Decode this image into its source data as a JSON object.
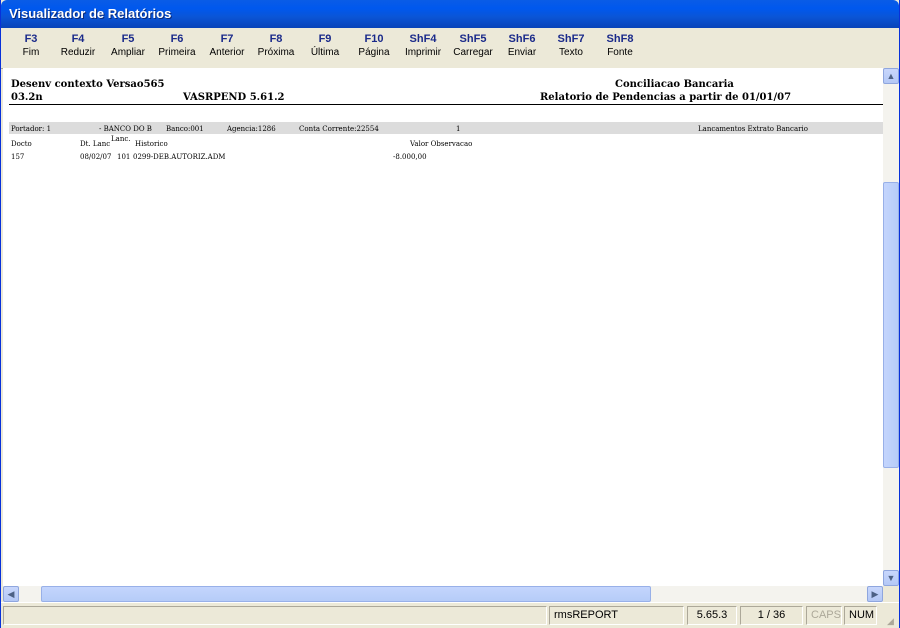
{
  "window": {
    "title": "Visualizador de Relatórios"
  },
  "toolbar": {
    "buttons": [
      {
        "key": "F3",
        "label": "Fim"
      },
      {
        "key": "F4",
        "label": "Reduzir"
      },
      {
        "key": "F5",
        "label": "Ampliar"
      },
      {
        "key": "F6",
        "label": "Primeira"
      },
      {
        "key": "F7",
        "label": "Anterior"
      },
      {
        "key": "F8",
        "label": "Próxima"
      },
      {
        "key": "F9",
        "label": "Última"
      },
      {
        "key": "F10",
        "label": "Página"
      },
      {
        "key": "ShF4",
        "label": "Imprimir"
      },
      {
        "key": "ShF5",
        "label": "Carregar"
      },
      {
        "key": "ShF6",
        "label": "Enviar"
      },
      {
        "key": "ShF7",
        "label": "Texto"
      },
      {
        "key": "ShF8",
        "label": "Fonte"
      }
    ]
  },
  "report": {
    "header_left_1": "Desenv contexto Versao565",
    "header_left_2": "03.2n",
    "header_center": "VASRPEND 5.61.2",
    "header_right_1": "Conciliacao Bancaria",
    "header_right_2": "Relatorio de Pendencias a partir de 01/01/07",
    "band": {
      "portador": "Portador: 1",
      "banco_nome": "- BANCO DO B",
      "banco": "Banco:001",
      "agencia": "Agencia:1286",
      "conta": "Conta Corrente:22554",
      "seq": "1",
      "titulo": "Lancamentos Extrato Bancario"
    },
    "columns": {
      "docto": "Docto",
      "dt_lanc": "Dt. Lanc",
      "lanc": "Lanc.",
      "historico": "Historico",
      "valor_obs": "Valor Observacao"
    },
    "row": {
      "docto": "157",
      "dt_lanc": "08/02/07",
      "lanc": "101",
      "historico": "0299-DEB.AUTORIZ.ADM",
      "valor": "-8.000,00"
    }
  },
  "statusbar": {
    "app": "rmsREPORT",
    "version": "5.65.3",
    "page": "1 / 36",
    "caps": "CAPS",
    "num": "NUM"
  },
  "icons": {
    "scroll_up": "▲",
    "scroll_down": "▼",
    "scroll_left": "◀",
    "scroll_right": "▶",
    "grip": "◢"
  }
}
